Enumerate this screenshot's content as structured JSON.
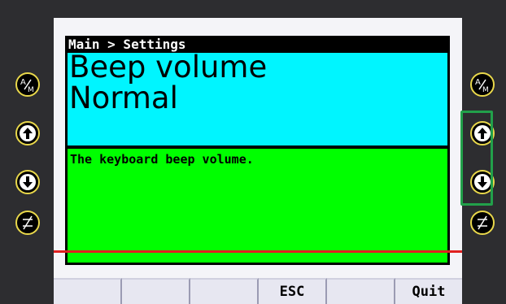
{
  "breadcrumb": "Main > Settings",
  "setting": {
    "name": "Beep volume",
    "value": "Normal",
    "description": "The keyboard beep volume."
  },
  "softkeys": [
    "",
    "",
    "",
    "ESC",
    "",
    "Quit"
  ],
  "hardware_buttons": {
    "left": [
      "auto-manual-icon",
      "arrow-up-icon",
      "arrow-down-icon",
      "adjust-icon"
    ],
    "right": [
      "auto-manual-icon",
      "arrow-up-icon",
      "arrow-down-icon",
      "adjust-icon"
    ]
  },
  "colors": {
    "title_panel": "#00f5ff",
    "description_panel": "#00ff00",
    "button_ring": "#e9d84b",
    "highlight": "#22a04a"
  }
}
